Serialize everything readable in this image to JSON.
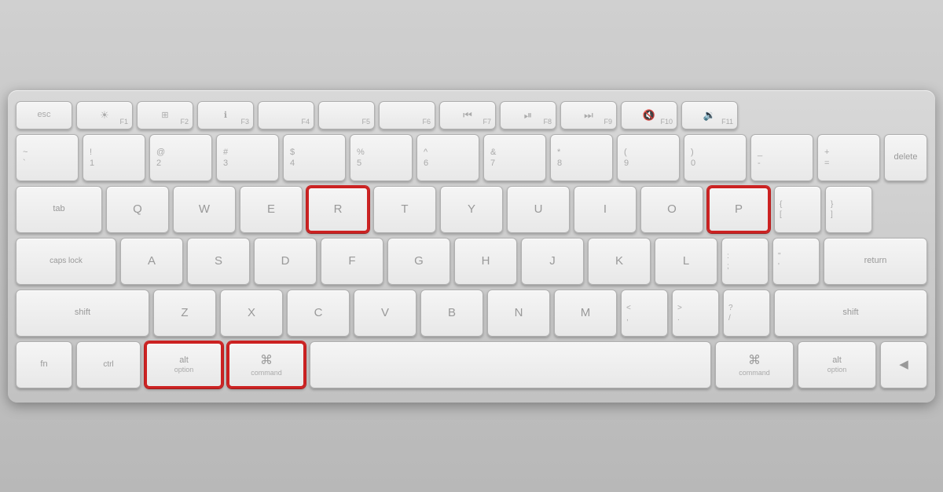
{
  "keyboard": {
    "rows": {
      "fn_row": {
        "keys": [
          {
            "id": "esc",
            "label": "esc",
            "width": "esc"
          },
          {
            "id": "f1",
            "icon": "☀",
            "fn": "F1",
            "width": "fn"
          },
          {
            "id": "f2",
            "icon": "⊞",
            "fn": "F2",
            "width": "fn"
          },
          {
            "id": "f3",
            "icon": "ℹ",
            "fn": "F3",
            "width": "fn"
          },
          {
            "id": "f4",
            "fn": "F4",
            "width": "fn"
          },
          {
            "id": "f5",
            "fn": "F5",
            "width": "fn"
          },
          {
            "id": "f6",
            "fn": "F6",
            "width": "fn"
          },
          {
            "id": "f7",
            "icon": "⏮",
            "fn": "F7",
            "width": "fn"
          },
          {
            "id": "f8",
            "icon": "⏯",
            "fn": "F8",
            "width": "fn"
          },
          {
            "id": "f9",
            "icon": "⏭",
            "fn": "F9",
            "width": "fn"
          },
          {
            "id": "f10",
            "icon": "🔇",
            "fn": "F10",
            "width": "fn"
          },
          {
            "id": "f11",
            "icon": "🔉",
            "fn": "F11",
            "width": "fn"
          }
        ]
      },
      "num_row": {
        "keys": [
          {
            "id": "tilde",
            "top": "~",
            "bottom": "`"
          },
          {
            "id": "1",
            "top": "!",
            "bottom": "1"
          },
          {
            "id": "2",
            "top": "@",
            "bottom": "2"
          },
          {
            "id": "3",
            "top": "#",
            "bottom": "3"
          },
          {
            "id": "4",
            "top": "$",
            "bottom": "4"
          },
          {
            "id": "5",
            "top": "%",
            "bottom": "5"
          },
          {
            "id": "6",
            "top": "^",
            "bottom": "6"
          },
          {
            "id": "7",
            "top": "&",
            "bottom": "7"
          },
          {
            "id": "8",
            "top": "*",
            "bottom": "8"
          },
          {
            "id": "9",
            "top": "(",
            "bottom": "9"
          },
          {
            "id": "0",
            "top": ")",
            "bottom": "0"
          },
          {
            "id": "minus",
            "top": "_",
            "bottom": "-"
          },
          {
            "id": "equals",
            "top": "+",
            "bottom": "="
          }
        ]
      },
      "qwerty_row": {
        "keys": [
          {
            "id": "q",
            "label": "Q"
          },
          {
            "id": "w",
            "label": "W"
          },
          {
            "id": "e",
            "label": "E"
          },
          {
            "id": "r",
            "label": "R",
            "highlighted": true
          },
          {
            "id": "t",
            "label": "T"
          },
          {
            "id": "y",
            "label": "Y"
          },
          {
            "id": "u",
            "label": "U"
          },
          {
            "id": "i",
            "label": "I"
          },
          {
            "id": "o",
            "label": "O"
          },
          {
            "id": "p",
            "label": "P",
            "highlighted": true
          },
          {
            "id": "lbracket",
            "top": "{",
            "bottom": "["
          },
          {
            "id": "rbracket",
            "top": "}",
            "bottom": "]"
          }
        ]
      },
      "asdf_row": {
        "keys": [
          {
            "id": "a",
            "label": "A"
          },
          {
            "id": "s",
            "label": "S"
          },
          {
            "id": "d",
            "label": "D"
          },
          {
            "id": "f",
            "label": "F"
          },
          {
            "id": "g",
            "label": "G"
          },
          {
            "id": "h",
            "label": "H"
          },
          {
            "id": "j",
            "label": "J"
          },
          {
            "id": "k",
            "label": "K"
          },
          {
            "id": "l",
            "label": "L"
          },
          {
            "id": "semicolon",
            "top": ":",
            "bottom": ";"
          },
          {
            "id": "quote",
            "top": "\"",
            "bottom": "'"
          }
        ]
      },
      "zxcv_row": {
        "keys": [
          {
            "id": "z",
            "label": "Z"
          },
          {
            "id": "x",
            "label": "X"
          },
          {
            "id": "c",
            "label": "C"
          },
          {
            "id": "v",
            "label": "V"
          },
          {
            "id": "b",
            "label": "B"
          },
          {
            "id": "n",
            "label": "N"
          },
          {
            "id": "m",
            "label": "M"
          },
          {
            "id": "comma",
            "top": "<",
            "bottom": ","
          },
          {
            "id": "period",
            "top": ">",
            "bottom": "."
          },
          {
            "id": "slash",
            "top": "?",
            "bottom": "/"
          }
        ]
      },
      "bottom_row": {
        "option_left": {
          "label": "alt",
          "sublabel": "option",
          "highlighted": true
        },
        "command_left": {
          "symbol": "⌘",
          "sublabel": "command",
          "highlighted": true
        },
        "space": {
          "label": ""
        },
        "command_right": {
          "symbol": "⌘",
          "sublabel": "command"
        },
        "option_right": {
          "label": "alt",
          "sublabel": "option"
        },
        "arrow": {
          "symbol": "◀"
        }
      }
    }
  }
}
